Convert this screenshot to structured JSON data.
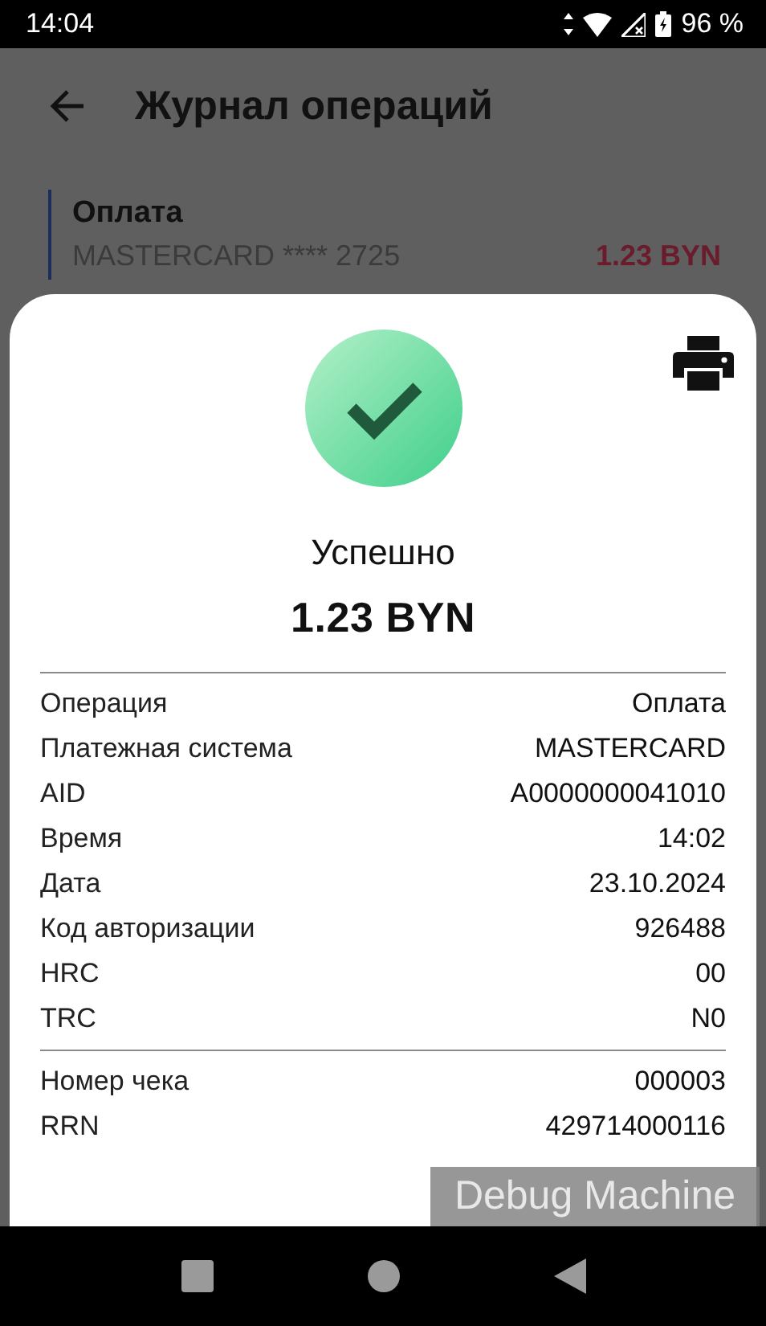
{
  "status_bar": {
    "time": "14:04",
    "battery": "96 %"
  },
  "app_bar": {
    "title": "Журнал операций"
  },
  "operations": [
    {
      "title": "Оплата",
      "card": "MASTERCARD **** 2725",
      "amount": "1.23 BYN"
    }
  ],
  "receipt": {
    "success": true,
    "status": "Успешно",
    "amount": "1.23 BYN",
    "sections": [
      [
        {
          "label": "Операция",
          "value": "Оплата"
        },
        {
          "label": "Платежная система",
          "value": "MASTERCARD"
        },
        {
          "label": "AID",
          "value": "A0000000041010"
        },
        {
          "label": "Время",
          "value": "14:02"
        },
        {
          "label": "Дата",
          "value": "23.10.2024"
        },
        {
          "label": "Код авторизации",
          "value": "926488"
        },
        {
          "label": "HRC",
          "value": "00"
        },
        {
          "label": "TRC",
          "value": "N0"
        }
      ],
      [
        {
          "label": "Номер чека",
          "value": "000003"
        },
        {
          "label": "RRN",
          "value": "429714000116"
        }
      ]
    ]
  },
  "overlay": {
    "label": "Debug Machine"
  }
}
